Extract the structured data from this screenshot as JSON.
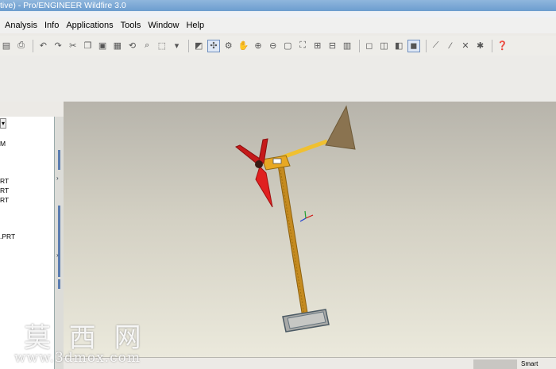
{
  "window": {
    "title": "tive) - Pro/ENGINEER Wildfire 3.0"
  },
  "menu": [
    "Analysis",
    "Info",
    "Applications",
    "Tools",
    "Window",
    "Help"
  ],
  "toolbar": [
    "open",
    "print",
    "undo",
    "redo",
    "cut",
    "copy",
    "paste",
    "paste-special",
    "regenerate",
    "find",
    "select-box",
    "repaint",
    "orient",
    "spin-center",
    "pan",
    "zoom-in",
    "zoom-out",
    "refit",
    "datum-planes",
    "datum-axes",
    "datum-points",
    "csys",
    "wireframe",
    "hidden-line",
    "no-hidden",
    "shading",
    "sketch",
    "axis",
    "point",
    "csys-display",
    "help"
  ],
  "tree": {
    "combo_label": "▾",
    "items": [
      "M",
      "RT",
      "RT",
      "RT",
      ".PRT"
    ]
  },
  "status": {
    "smart": "Smart"
  },
  "watermark": {
    "cn": "莫 西 网",
    "url": "www.3dmox.com"
  }
}
